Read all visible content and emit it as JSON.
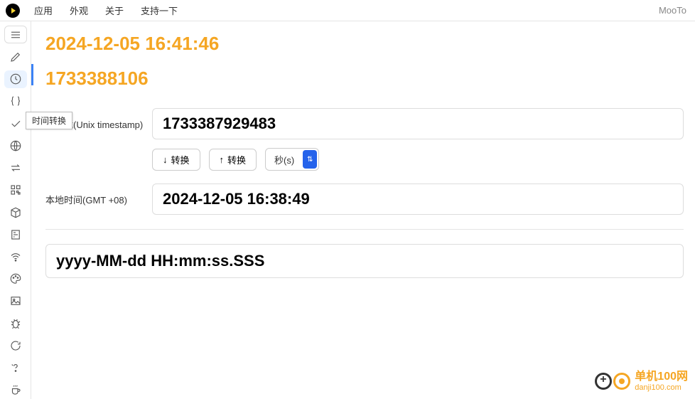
{
  "menubar": {
    "items": [
      "应用",
      "外观",
      "关于",
      "支持一下"
    ],
    "app_name": "MooTo"
  },
  "tooltip": "时间转换",
  "header": {
    "datetime": "2024-12-05 16:41:46",
    "timestamp": "1733388106"
  },
  "form": {
    "timestamp_label": "时间戳(Unix timestamp)",
    "timestamp_value": "1733387929483",
    "convert_down": "转换",
    "convert_up": "转换",
    "unit_selected": "秒(s)",
    "localtime_label": "本地时间(GMT +08)",
    "localtime_value": "2024-12-05 16:38:49",
    "format_value": "yyyy-MM-dd HH:mm:ss.SSS"
  },
  "watermark": {
    "cn": "单机100网",
    "en": "danji100.com"
  }
}
